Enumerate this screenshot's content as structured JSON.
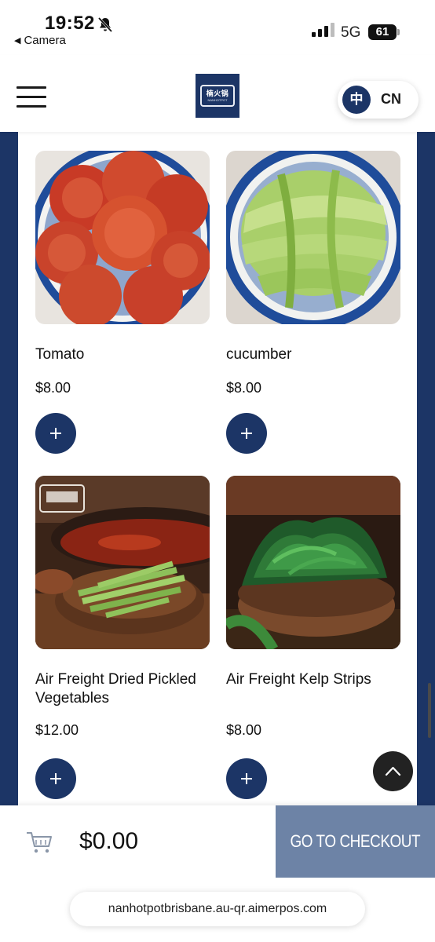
{
  "status_bar": {
    "time": "19:52",
    "back_label": "Camera",
    "network": "5G",
    "battery": "61"
  },
  "header": {
    "logo_text": "楠火锅",
    "logo_subtext": "NANHOTPOT",
    "lang_char": "中",
    "lang_label": "CN"
  },
  "products": [
    {
      "name": "Tomato",
      "price": "$8.00"
    },
    {
      "name": "cucumber",
      "price": "$8.00"
    },
    {
      "name": "Air Freight Dried Pickled Vegetables",
      "price": "$12.00"
    },
    {
      "name": "Air Freight Kelp Strips",
      "price": "$8.00"
    }
  ],
  "cart": {
    "total": "$0.00",
    "checkout_label": "GO TO CHECKOUT"
  },
  "browser": {
    "url": "nanhotpotbrisbane.au-qr.aimerpos.com"
  },
  "colors": {
    "brand_navy": "#1c3566",
    "checkout_bg": "#6d83a6"
  }
}
